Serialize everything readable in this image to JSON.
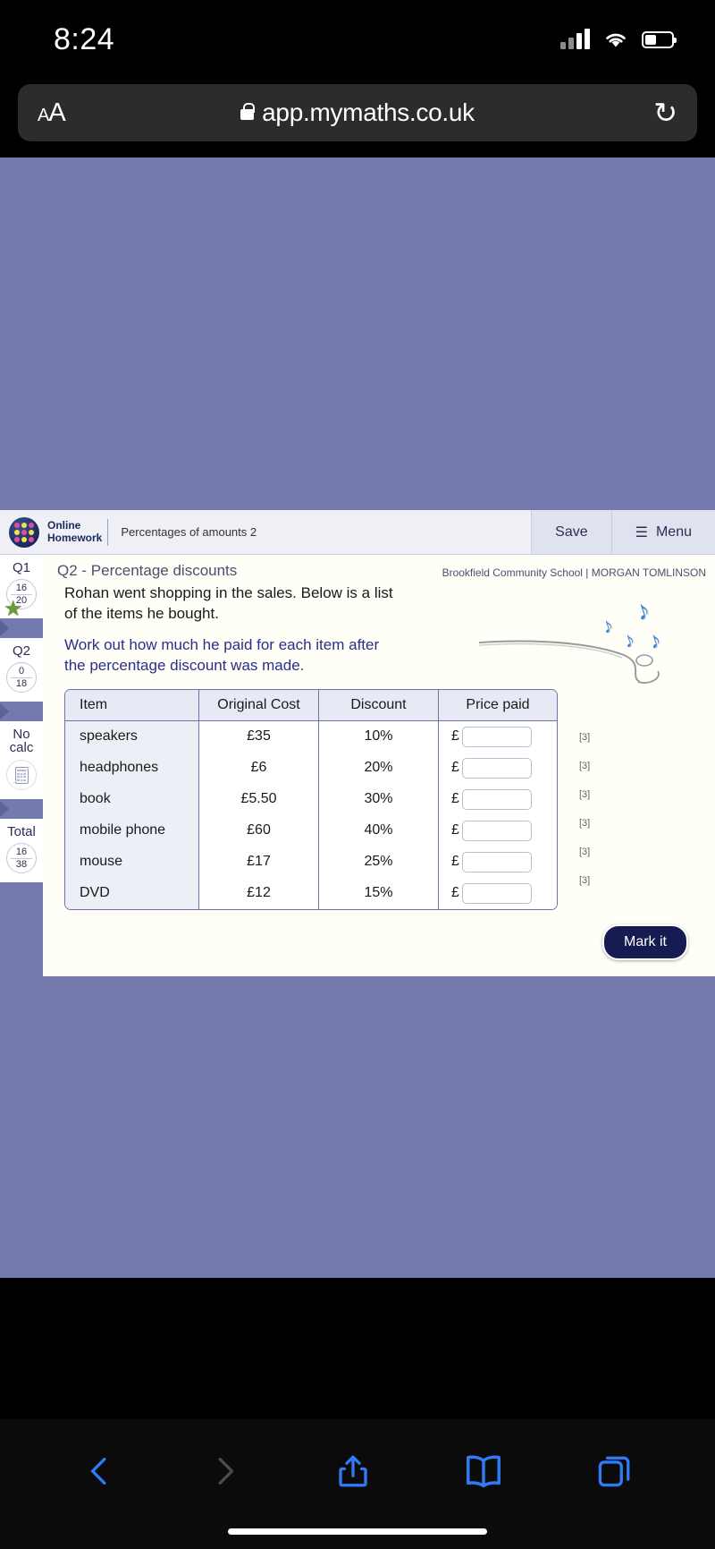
{
  "status_bar": {
    "time": "8:24",
    "signal_icon": "cellular-bars-icon",
    "wifi_icon": "wifi-icon",
    "battery_icon": "battery-icon"
  },
  "browser": {
    "text_size_label": "AA",
    "lock_icon": "lock-icon",
    "url": "app.mymaths.co.uk",
    "reload_icon": "reload-icon",
    "toolbar": {
      "back_icon": "chevron-left-icon",
      "forward_icon": "chevron-right-icon",
      "share_icon": "share-icon",
      "bookmarks_icon": "book-icon",
      "tabs_icon": "tabs-icon"
    }
  },
  "app_header": {
    "logo_icon": "mymaths-dots-logo",
    "brand_line1": "Online",
    "brand_line2": "Homework",
    "lesson_title": "Percentages of amounts 2",
    "save_label": "Save",
    "menu_label": "Menu",
    "menu_icon": "hamburger-icon"
  },
  "sidebar": {
    "nodes": [
      {
        "label": "Q1",
        "score": "16",
        "total": "20",
        "star_icon": "star-icon",
        "has_star": true
      },
      {
        "label": "Q2",
        "score": "0",
        "total": "18",
        "has_star": false
      },
      {
        "label_line1": "No",
        "label_line2": "calc",
        "icon": "no-calculator-icon"
      },
      {
        "label": "Total",
        "score": "16",
        "total": "38"
      }
    ]
  },
  "question": {
    "heading": "Q2 - Percentage discounts",
    "school_user": "Brookfield Community School | MORGAN TOMLINSON",
    "body": "Rohan went shopping in the sales. Below is a list of the items he bought.",
    "instruction": "Work out how much he paid for each item after the percentage discount was made.",
    "decoration_icon": "headphones-with-music-notes-doodle",
    "note_glyph": "♪"
  },
  "table": {
    "headers": [
      "Item",
      "Original Cost",
      "Discount",
      "Price paid"
    ],
    "currency_symbol": "£",
    "rows": [
      {
        "item": "speakers",
        "cost": "£35",
        "discount": "10%",
        "answer": "",
        "marks": "[3]"
      },
      {
        "item": "headphones",
        "cost": "£6",
        "discount": "20%",
        "answer": "",
        "marks": "[3]"
      },
      {
        "item": "book",
        "cost": "£5.50",
        "discount": "30%",
        "answer": "",
        "marks": "[3]"
      },
      {
        "item": "mobile phone",
        "cost": "£60",
        "discount": "40%",
        "answer": "",
        "marks": "[3]"
      },
      {
        "item": "mouse",
        "cost": "£17",
        "discount": "25%",
        "answer": "",
        "marks": "[3]"
      },
      {
        "item": "DVD",
        "cost": "£12",
        "discount": "15%",
        "answer": "",
        "marks": "[3]"
      }
    ]
  },
  "actions": {
    "mark_it_label": "Mark it"
  },
  "colors": {
    "page_background": "#7479ae",
    "content_background": "#fffef7",
    "accent_blue": "#2b2f8a",
    "button_navy": "#161c52",
    "browser_blue": "#2f7bf6",
    "note_blue": "#3f87d6"
  }
}
